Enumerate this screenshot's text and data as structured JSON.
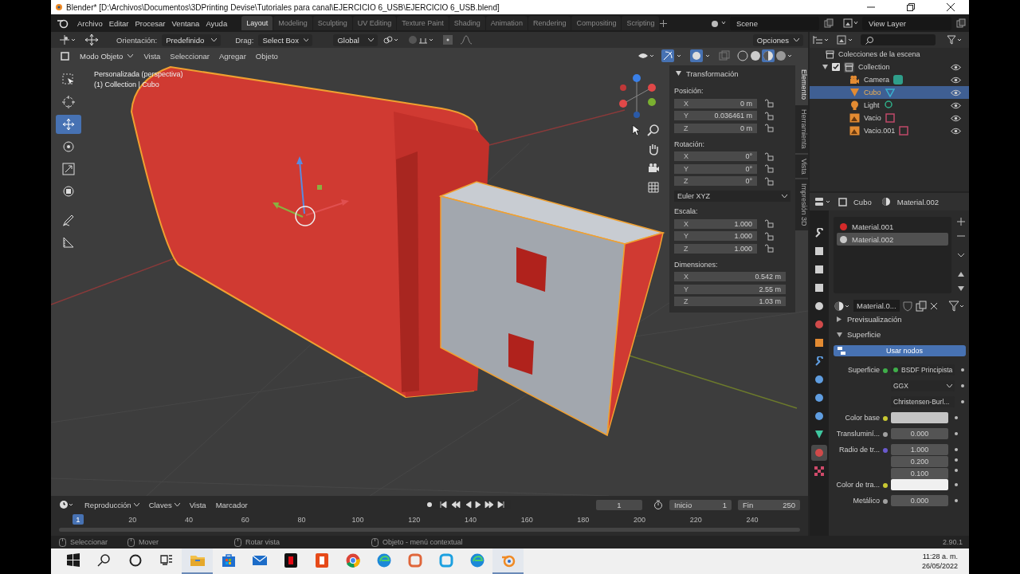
{
  "window": {
    "title": "Blender* [D:\\Archivos\\Documentos\\3DPrinting Devise\\Tutoriales para canal\\EJERCICIO 6_USB\\EJERCICIO 6_USB.blend]"
  },
  "menu": [
    "Archivo",
    "Editar",
    "Procesar",
    "Ventana",
    "Ayuda"
  ],
  "workspaces": [
    {
      "label": "Layout",
      "selected": true
    },
    {
      "label": "Modeling",
      "selected": false
    },
    {
      "label": "Sculpting",
      "selected": false
    },
    {
      "label": "UV Editing",
      "selected": false
    },
    {
      "label": "Texture Paint",
      "selected": false
    },
    {
      "label": "Shading",
      "selected": false
    },
    {
      "label": "Animation",
      "selected": false
    },
    {
      "label": "Rendering",
      "selected": false
    },
    {
      "label": "Compositing",
      "selected": false
    },
    {
      "label": "Scripting",
      "selected": false
    }
  ],
  "scene": "Scene",
  "view_layer": "View Layer",
  "tool_header": {
    "orientation_label": "Orientación:",
    "orientation": "Predefinido",
    "drag_label": "Drag:",
    "drag": "Select Box",
    "transform": "Global",
    "options": "Opciones"
  },
  "viewport_header": {
    "mode": "Modo Objeto",
    "menus": [
      "Vista",
      "Seleccionar",
      "Agregar",
      "Objeto"
    ]
  },
  "viewport": {
    "view_name": "Personalizada (perspectiva)",
    "object_info": "(1) Collection | Cubo"
  },
  "tools": [
    {
      "kind": "select",
      "selected": false
    },
    {
      "kind": "cursor",
      "selected": false
    },
    {
      "kind": "move",
      "selected": true
    },
    {
      "kind": "rotate",
      "selected": false
    },
    {
      "kind": "scale",
      "selected": false
    },
    {
      "kind": "transform",
      "selected": false
    },
    {
      "kind": "annotate",
      "selected": false
    },
    {
      "kind": "measure",
      "selected": false
    }
  ],
  "n_panel": {
    "title": "Transformación",
    "tabs": [
      {
        "label": "Elemento",
        "selected": true
      },
      {
        "label": "Herramienta",
        "selected": false
      },
      {
        "label": "Vista",
        "selected": false
      },
      {
        "label": "Impresión 3D",
        "selected": false
      }
    ],
    "groups": [
      {
        "kind": "vector",
        "label": "Posición:",
        "lockable": true,
        "rows": [
          {
            "axis": "X",
            "value": "0 m"
          },
          {
            "axis": "Y",
            "value": "0.036461 m"
          },
          {
            "axis": "Z",
            "value": "0 m"
          }
        ]
      },
      {
        "kind": "vector",
        "label": "Rotación:",
        "lockable": true,
        "rows": [
          {
            "axis": "X",
            "value": "0°"
          },
          {
            "axis": "Y",
            "value": "0°"
          },
          {
            "axis": "Z",
            "value": "0°"
          }
        ]
      },
      {
        "kind": "dropdown",
        "value": "Euler XYZ"
      },
      {
        "kind": "vector",
        "label": "Escala:",
        "lockable": true,
        "rows": [
          {
            "axis": "X",
            "value": "1.000"
          },
          {
            "axis": "Y",
            "value": "1.000"
          },
          {
            "axis": "Z",
            "value": "1.000"
          }
        ]
      },
      {
        "kind": "vector",
        "label": "Dimensiones:",
        "lockable": false,
        "rows": [
          {
            "axis": "X",
            "value": "0.542 m"
          },
          {
            "axis": "Y",
            "value": "2.55 m"
          },
          {
            "axis": "Z",
            "value": "1.03 m"
          }
        ]
      }
    ]
  },
  "outliner": {
    "title": "Colecciones de la escena",
    "items": [
      {
        "label": "Collection",
        "kind": "collection",
        "expanded": true,
        "checked": true,
        "visible": true,
        "selected": false,
        "children": [
          {
            "label": "Camera",
            "kind": "camera",
            "visible": true,
            "selected": false
          },
          {
            "label": "Cubo",
            "kind": "mesh",
            "visible": true,
            "selected": true
          },
          {
            "label": "Light",
            "kind": "light",
            "visible": true,
            "selected": false
          },
          {
            "label": "Vacio",
            "kind": "empty",
            "visible": true,
            "selected": false
          },
          {
            "label": "Vacio.001",
            "kind": "empty",
            "visible": true,
            "selected": false
          }
        ]
      }
    ]
  },
  "properties": {
    "object": "Cubo",
    "material": "Material.002",
    "tabs": [
      {
        "kind": "tool",
        "selected": false
      },
      {
        "kind": "render",
        "selected": false
      },
      {
        "kind": "output",
        "selected": false
      },
      {
        "kind": "view_layer",
        "selected": false
      },
      {
        "kind": "scene",
        "selected": false
      },
      {
        "kind": "world",
        "selected": false
      },
      {
        "kind": "object",
        "selected": false
      },
      {
        "kind": "modifier",
        "selected": false
      },
      {
        "kind": "particles",
        "selected": false
      },
      {
        "kind": "physics",
        "selected": false
      },
      {
        "kind": "constraints",
        "selected": false
      },
      {
        "kind": "data",
        "selected": false
      },
      {
        "kind": "material",
        "selected": true
      },
      {
        "kind": "texture",
        "selected": false
      }
    ],
    "slots": [
      {
        "name": "Material.001",
        "color": "#d42a2a",
        "selected": false
      },
      {
        "name": "Material.002",
        "color": "#c8c8c8",
        "selected": true
      }
    ],
    "material_field": "Material.0...",
    "panels": [
      {
        "label": "Previsualización",
        "expanded": false
      },
      {
        "label": "Superficie",
        "expanded": true
      }
    ],
    "use_nodes": "Usar nodos",
    "rows": [
      {
        "kind": "shader",
        "label": "Superficie",
        "color": "#3fae4a",
        "value": "BSDF Principista"
      },
      {
        "kind": "dropdown",
        "value": "GGX"
      },
      {
        "kind": "dropdown",
        "value": "Christensen-Burl..."
      },
      {
        "kind": "color",
        "label": "Color base",
        "color": "#c8c832",
        "swatch": {
          "color": "#c4c4c4"
        }
      },
      {
        "kind": "number",
        "label": "Transluminí...",
        "color": "#a0a0a0",
        "value": "0.000"
      },
      {
        "kind": "vector",
        "label": "Radio de tr...",
        "color": "#6a5acd",
        "values": [
          "1.000",
          "0.200",
          "0.100"
        ]
      },
      {
        "kind": "color",
        "label": "Color de tra...",
        "color": "#c8c832",
        "swatch": {
          "color": "#f0f0f0"
        }
      },
      {
        "kind": "number",
        "label": "Metálico",
        "color": "#a0a0a0",
        "value": "0.000"
      }
    ]
  },
  "timeline": {
    "menus": [
      "Reproducción",
      "Claves",
      "Vista",
      "Marcador"
    ],
    "current": "1",
    "start_label": "Inicio",
    "start": "1",
    "end_label": "Fin",
    "end": "250",
    "playhead": "1",
    "ticks": [
      "20",
      "40",
      "60",
      "80",
      "100",
      "120",
      "140",
      "160",
      "180",
      "200",
      "220",
      "240"
    ]
  },
  "status_bar": {
    "items": [
      "Seleccionar",
      "Mover",
      "Rotar vista",
      "Objeto - menú contextual"
    ],
    "version": "2.90.1"
  },
  "taskbar": {
    "apps": [
      {
        "kind": "start",
        "open": false
      },
      {
        "kind": "search",
        "open": false
      },
      {
        "kind": "cortana",
        "open": false
      },
      {
        "kind": "taskview",
        "open": false
      },
      {
        "kind": "folder",
        "open": true
      },
      {
        "kind": "store",
        "open": false
      },
      {
        "kind": "mail",
        "open": false
      },
      {
        "kind": "netflix",
        "open": false
      },
      {
        "kind": "office",
        "open": false
      },
      {
        "kind": "chrome",
        "open": false
      },
      {
        "kind": "edge",
        "open": false
      },
      {
        "kind": "paint",
        "open": false
      },
      {
        "kind": "cbox",
        "open": false
      },
      {
        "kind": "edge",
        "open": false
      },
      {
        "kind": "blender",
        "open": true
      }
    ],
    "time": "11:28 a. m.",
    "date": "26/05/2022"
  }
}
